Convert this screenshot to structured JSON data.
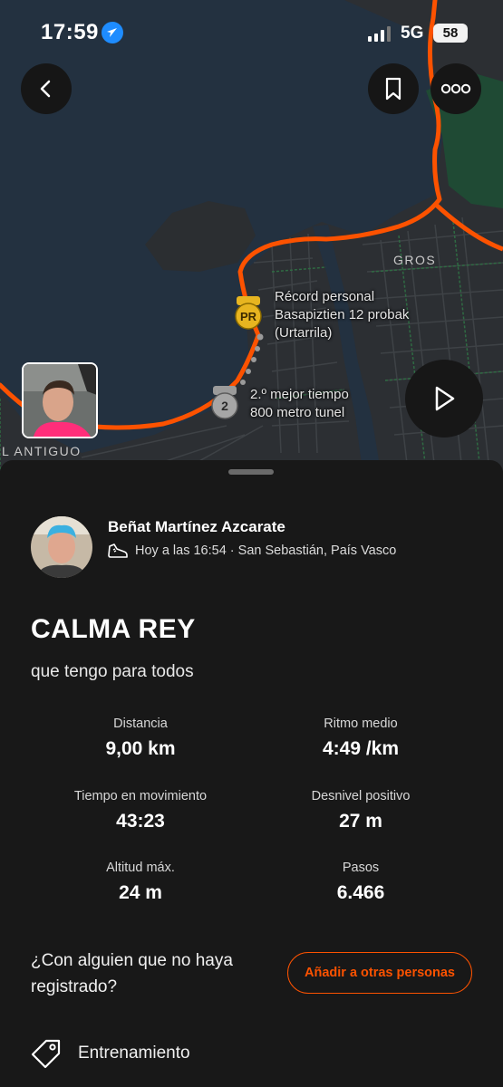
{
  "status_bar": {
    "time": "17:59",
    "network": "5G",
    "battery": "58"
  },
  "map": {
    "pr_label_line1": "Récord personal",
    "pr_label_line2": "Basapiztien 12 probak",
    "pr_label_line3": "(Urtarrila)",
    "pr_badge": "PR",
    "second_label_line1": "2.º mejor tiempo",
    "second_label_line2": "800 metro tunel",
    "second_badge": "2",
    "district_gros": "GROS",
    "district_antiguo": "L ANTIGUO",
    "route_color": "#fc5200"
  },
  "activity": {
    "athlete_name": "Beñat Martínez Azcarate",
    "meta": "Hoy a las 16:54 · San Sebastián, País Vasco",
    "title": "CALMA REY",
    "description": "que tengo para todos",
    "stats": [
      {
        "label": "Distancia",
        "value": "9,00 km"
      },
      {
        "label": "Ritmo medio",
        "value": "4:49 /km"
      },
      {
        "label": "Tiempo en movimiento",
        "value": "43:23"
      },
      {
        "label": "Desnivel positivo",
        "value": "27 m"
      },
      {
        "label": "Altitud máx.",
        "value": "24 m"
      },
      {
        "label": "Pasos",
        "value": "6.466"
      }
    ],
    "tag_question": "¿Con alguien que no haya registrado?",
    "add_others_label": "Añadir a otras personas",
    "workout_type": "Entrenamiento"
  },
  "colors": {
    "accent": "#fc5200",
    "background": "#181818",
    "map_water": "#233140"
  },
  "icons": [
    "location-arrow-icon",
    "signal-icon",
    "back-icon",
    "bookmark-icon",
    "more-icon",
    "play-icon",
    "shoe-icon",
    "tag-icon",
    "pr-medal-icon",
    "second-medal-icon"
  ]
}
